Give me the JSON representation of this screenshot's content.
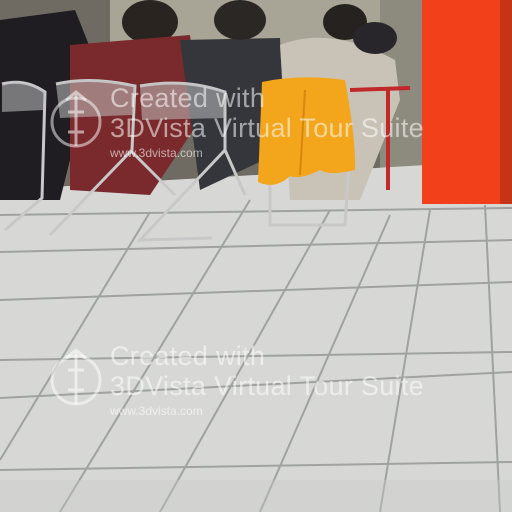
{
  "scene": {
    "colors": {
      "floor": "#d7d8d6",
      "grout": "#9fa2a0",
      "pillar": "#f2411a",
      "jacket": "#f3a51b",
      "wall": "#b8b6a8"
    }
  },
  "watermarks": [
    {
      "line1": "Created with",
      "line2": "3DVista Virtual Tour Suite",
      "url": "www.3dvista.com"
    },
    {
      "line1": "Created with",
      "line2": "3DVista Virtual Tour Suite",
      "url": "www.3dvista.com"
    }
  ]
}
